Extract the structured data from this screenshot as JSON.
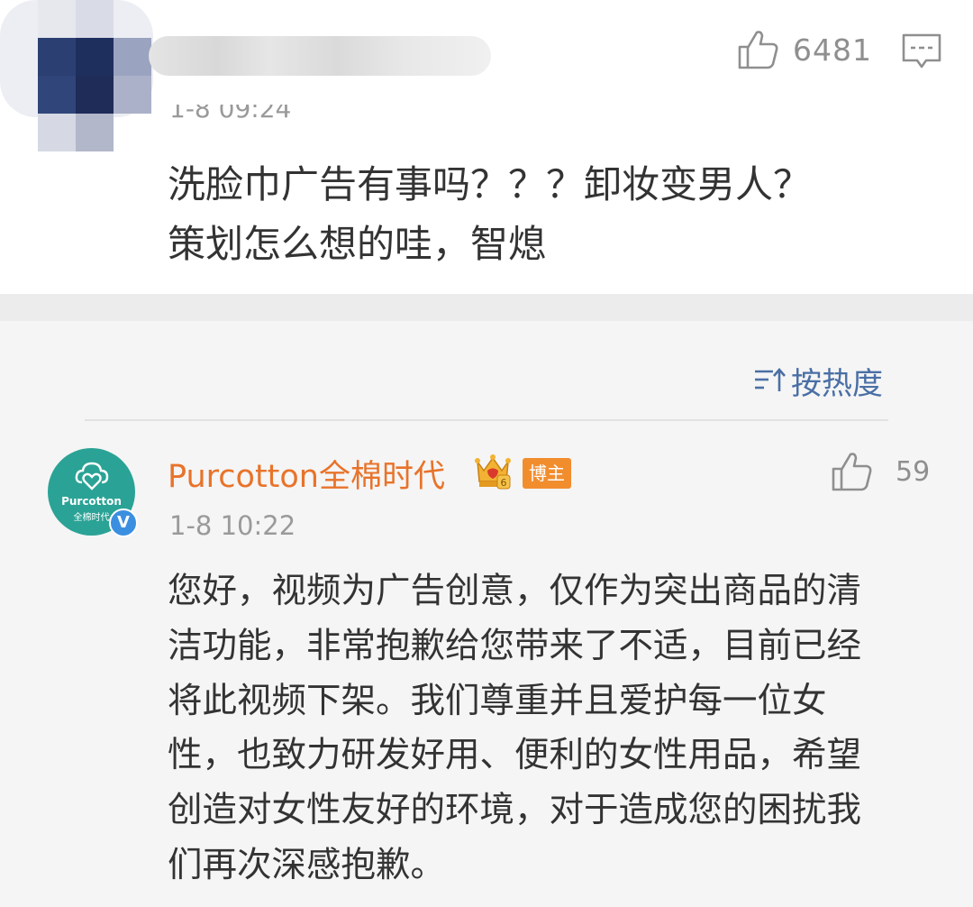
{
  "top_comment": {
    "date": "1-8 09:24",
    "like_count": "6481",
    "text_lines": [
      "洗脸巾广告有事吗？？？卸妆变男人？",
      "策划怎么想的哇，智熄"
    ],
    "icons": {
      "like": "thumbs-up-icon",
      "comment": "comment-icon"
    }
  },
  "sort": {
    "label": "按热度",
    "icon": "sort-icon"
  },
  "reply": {
    "author": "Purcotton全棉时代",
    "avatar": {
      "brand_en": "Purcotton",
      "brand_cn": "全棉时代"
    },
    "badge_label": "博主",
    "badge_color": "#f28d2e",
    "verified_mark": "V",
    "date": "1-8 10:22",
    "like_count": "59",
    "text_lines": [
      "您好，视频为广告创意，仅作为突出商品的清",
      "洁功能，非常抱歉给您带来了不适，目前已经",
      "将此视频下架。我们尊重并且爱护每一位女",
      "性，也致力研发好用、便利的女性用品，希望",
      "创造对女性友好的环境，对于造成您的困扰我",
      "们再次深感抱歉。"
    ],
    "icons": {
      "like": "thumbs-up-icon",
      "crown": "crown-badge-icon"
    }
  },
  "colors": {
    "author": "#e8732a",
    "link": "#4a6fa5",
    "avatar_bg": "#2aa396"
  }
}
